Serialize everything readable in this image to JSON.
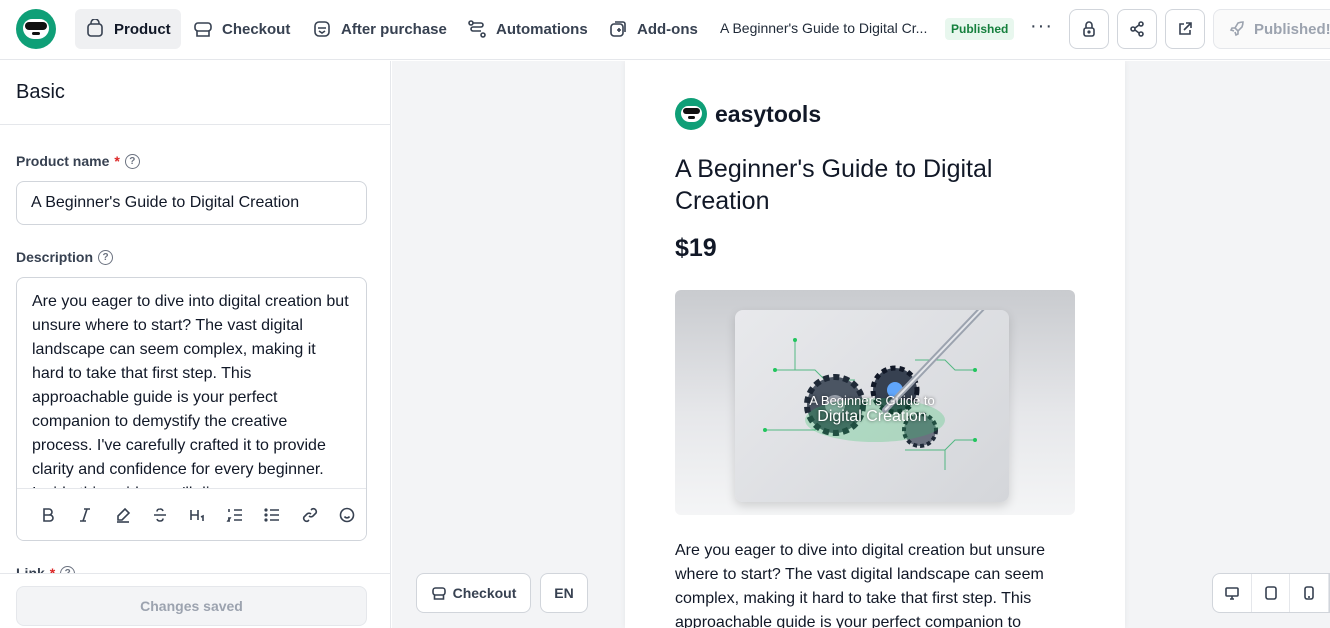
{
  "nav": {
    "tabs": [
      {
        "label": "Product",
        "icon": "store-icon"
      },
      {
        "label": "Checkout",
        "icon": "cart-icon"
      },
      {
        "label": "After purchase",
        "icon": "package-icon"
      },
      {
        "label": "Automations",
        "icon": "flow-icon"
      },
      {
        "label": "Add-ons",
        "icon": "addon-icon"
      }
    ],
    "breadcrumb": "A Beginner's Guide to Digital Cr...",
    "status_badge": "Published",
    "more": "···",
    "publish_label": "Published!"
  },
  "sidebar": {
    "section_title": "Basic",
    "product_name_label": "Product name",
    "required_mark": "*",
    "product_name_value": "A Beginner's Guide to Digital Creation",
    "description_label": "Description",
    "description_value": "Are you eager to dive into digital creation but unsure where to start? The vast digital landscape can seem complex, making it hard to take that first step. This approachable guide is your perfect companion to demystify the creative process. I've carefully crafted it to provide clarity and confidence for every beginner. Inside this guide, you'll discover",
    "link_label": "Link",
    "save_label": "Changes saved",
    "toolbar": [
      "bold-icon",
      "italic-icon",
      "highlight-icon",
      "strikethrough-icon",
      "heading-icon",
      "ordered-list-icon",
      "bullet-list-icon",
      "link-icon",
      "emoji-icon"
    ]
  },
  "preview": {
    "brand_name": "easytools",
    "product_title": "A Beginner's Guide to Digital Creation",
    "price": "$19",
    "hero_line1": "A Beginner's Guide to",
    "hero_line2": "Digital Creation",
    "body_text": "Are you eager to dive into digital creation but unsure where to start? The vast digital landscape can seem complex, making it hard to take that first step. This approachable guide is your perfect companion to",
    "checkout_label": "Checkout",
    "language": "EN"
  },
  "colors": {
    "brand": "#0f9f77",
    "badge_bg": "#e8f7ee",
    "badge_text": "#15803d",
    "required": "#dc2626"
  }
}
